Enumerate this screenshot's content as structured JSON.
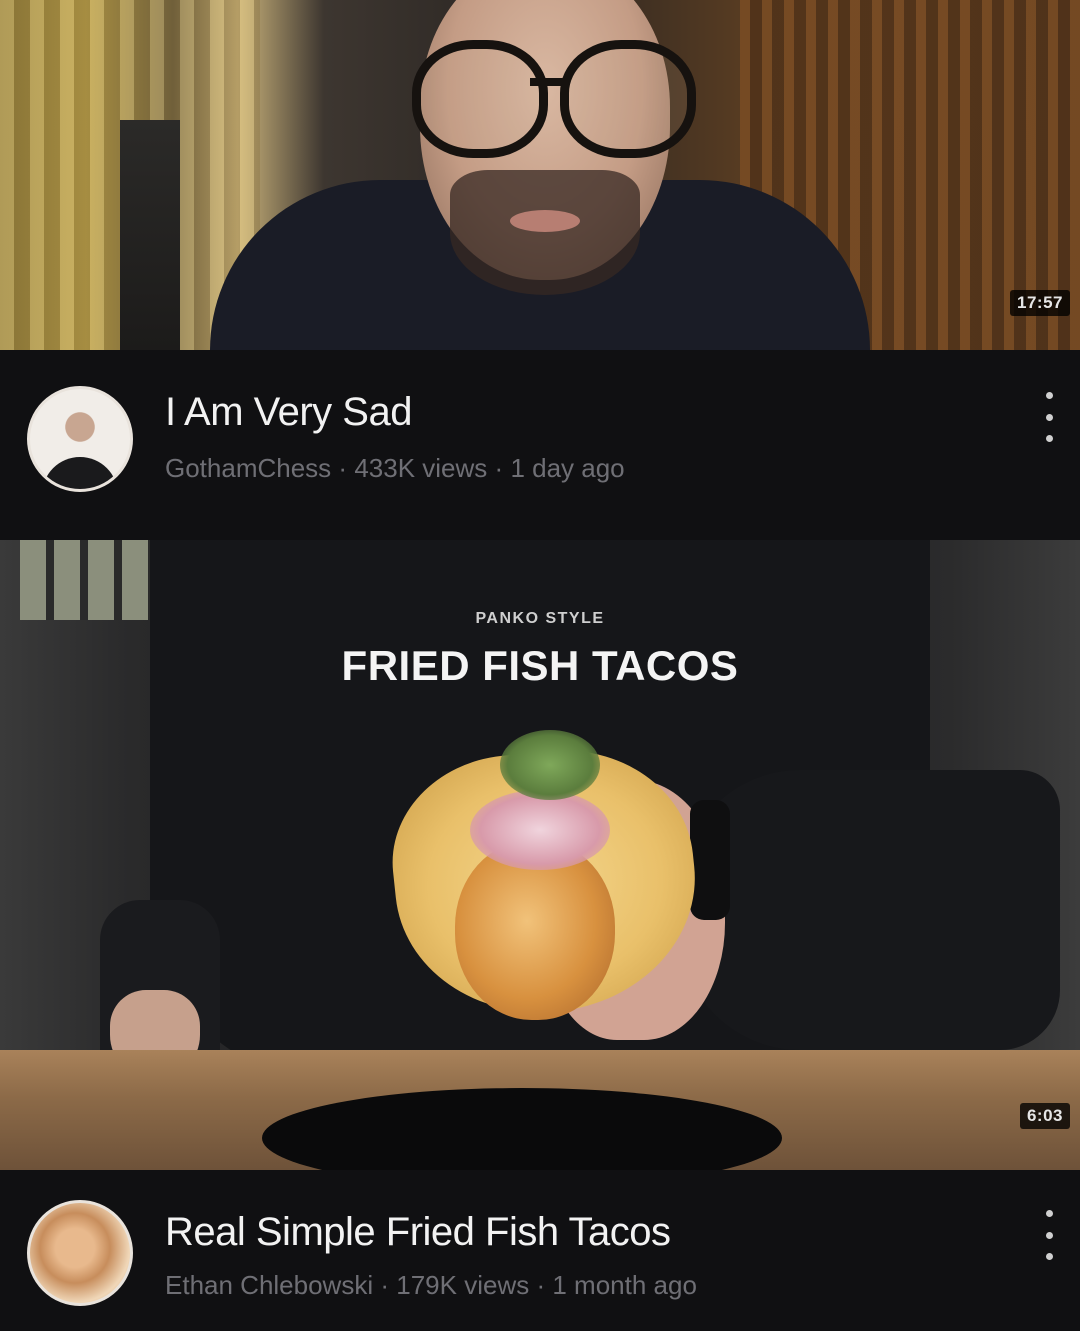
{
  "videos": [
    {
      "title": "I Am Very Sad",
      "channel": "GothamChess",
      "views": "433K views",
      "age": "1 day ago",
      "duration": "17:57",
      "separator": "·",
      "thumbnail_overlay": {
        "kicker": "",
        "headline": ""
      }
    },
    {
      "title": "Real Simple Fried Fish Tacos",
      "channel": "Ethan Chlebowski",
      "views": "179K views",
      "age": "1 month ago",
      "duration": "6:03",
      "separator": "·",
      "thumbnail_overlay": {
        "kicker": "PANKO STYLE",
        "headline": "FRIED FISH TACOS"
      }
    }
  ],
  "icons": {
    "more_actions": "vertical-ellipsis-icon"
  },
  "colors": {
    "background": "#101012",
    "title_text": "#f2f2f2",
    "meta_text": "#6f6f75",
    "duration_badge": "#000000"
  }
}
